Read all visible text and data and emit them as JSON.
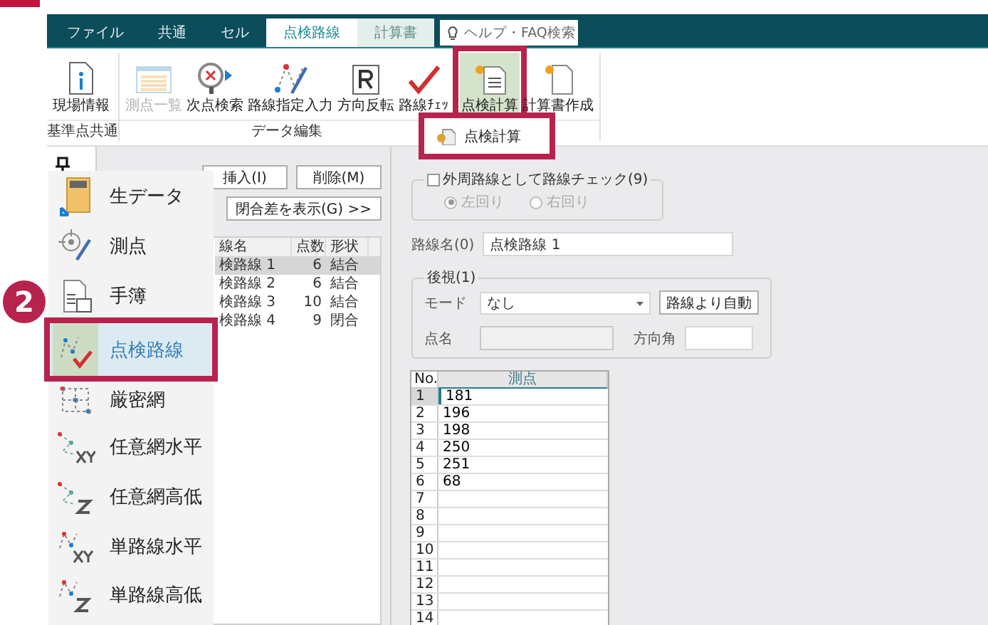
{
  "tabs": [
    {
      "label": "ファイル",
      "selected": false,
      "kind": "normal"
    },
    {
      "label": "共通",
      "selected": false,
      "kind": "normal"
    },
    {
      "label": "セル",
      "selected": false,
      "kind": "normal"
    },
    {
      "label": "点検路線",
      "selected": true,
      "kind": "normal"
    },
    {
      "label": "計算書",
      "selected": false,
      "kind": "context"
    }
  ],
  "search": {
    "placeholder": "ヘルプ・FAQ検索"
  },
  "ribbon": {
    "groups": [
      {
        "label": "基準点共通",
        "buttons": [
          {
            "label": "現場情報",
            "disabled": false,
            "highlighted": false
          }
        ]
      },
      {
        "label": "データ編集",
        "buttons": [
          {
            "label": "測点一覧",
            "disabled": true,
            "highlighted": false
          },
          {
            "label": "次点検索",
            "disabled": false,
            "highlighted": false
          },
          {
            "label": "路線指定入力",
            "disabled": false,
            "highlighted": false
          },
          {
            "label": "方向反転",
            "disabled": false,
            "highlighted": false
          },
          {
            "label": "路線ﾁｪｯ",
            "disabled": false,
            "highlighted": false
          }
        ]
      },
      {
        "buttons": [
          {
            "label": "点検計算",
            "disabled": false,
            "highlighted": true
          },
          {
            "label": "計算書作成",
            "disabled": false,
            "highlighted": false
          }
        ]
      }
    ]
  },
  "dropdown": {
    "highlighted": true,
    "items": [
      {
        "label": "点検計算"
      }
    ]
  },
  "left_panel": {
    "buttons": [
      {
        "label": "挿入(I)",
        "disabled": false
      },
      {
        "label": "削除(M)",
        "disabled": false
      }
    ],
    "show_button": "閉合差を表示(G) >>",
    "columns": [
      "線名",
      "点数",
      "形状"
    ],
    "rows": [
      {
        "name": "検路線 1",
        "count": "6",
        "shape": "結合",
        "selected": true
      },
      {
        "name": "検路線 2",
        "count": "6",
        "shape": "結合",
        "selected": false
      },
      {
        "name": "検路線 3",
        "count": "10",
        "shape": "結合",
        "selected": false
      },
      {
        "name": "検路線 4",
        "count": "9",
        "shape": "閉合",
        "selected": false
      }
    ]
  },
  "flyout": {
    "items": [
      {
        "label": "生データ",
        "selected": false,
        "highlighted": false
      },
      {
        "label": "測点",
        "selected": false,
        "highlighted": false
      },
      {
        "label": "手簿",
        "selected": false,
        "highlighted": false
      },
      {
        "label": "点検路線",
        "selected": true,
        "highlighted": true
      },
      {
        "label": "厳密網",
        "selected": false,
        "highlighted": false
      },
      {
        "label": "任意網水平",
        "selected": false,
        "highlighted": false
      },
      {
        "label": "任意網高低",
        "selected": false,
        "highlighted": false
      },
      {
        "label": "単路線水平",
        "selected": false,
        "highlighted": false
      },
      {
        "label": "単路線高低",
        "selected": false,
        "highlighted": false
      }
    ]
  },
  "badge": "2",
  "right_panel": {
    "check": {
      "label": "外周路線として路線チェック(9)",
      "checked": false
    },
    "radios": [
      {
        "label": "左回り",
        "selected": true
      },
      {
        "label": "右回り",
        "selected": false
      }
    ],
    "route_name": {
      "label": "路線名(0)",
      "value": "点検路線 1"
    },
    "backsight": {
      "title": "後視(1)",
      "mode_label": "モード",
      "mode_value": "なし",
      "auto_button": "路線より自動",
      "point_label": "点名",
      "angle_label": "方向角"
    },
    "grid": {
      "columns": [
        "No.",
        "測点"
      ],
      "rows": [
        {
          "no": "1",
          "point": "181",
          "selected": true
        },
        {
          "no": "2",
          "point": "196",
          "selected": false
        },
        {
          "no": "3",
          "point": "198",
          "selected": false
        },
        {
          "no": "4",
          "point": "250",
          "selected": false
        },
        {
          "no": "5",
          "point": "251",
          "selected": false
        },
        {
          "no": "6",
          "point": "68",
          "selected": false
        },
        {
          "no": "7",
          "point": "",
          "selected": false
        },
        {
          "no": "8",
          "point": "",
          "selected": false
        },
        {
          "no": "9",
          "point": "",
          "selected": false
        },
        {
          "no": "10",
          "point": "",
          "selected": false
        },
        {
          "no": "11",
          "point": "",
          "selected": false
        },
        {
          "no": "12",
          "point": "",
          "selected": false
        },
        {
          "no": "13",
          "point": "",
          "selected": false
        },
        {
          "no": "14",
          "point": "",
          "selected": false
        }
      ]
    }
  }
}
